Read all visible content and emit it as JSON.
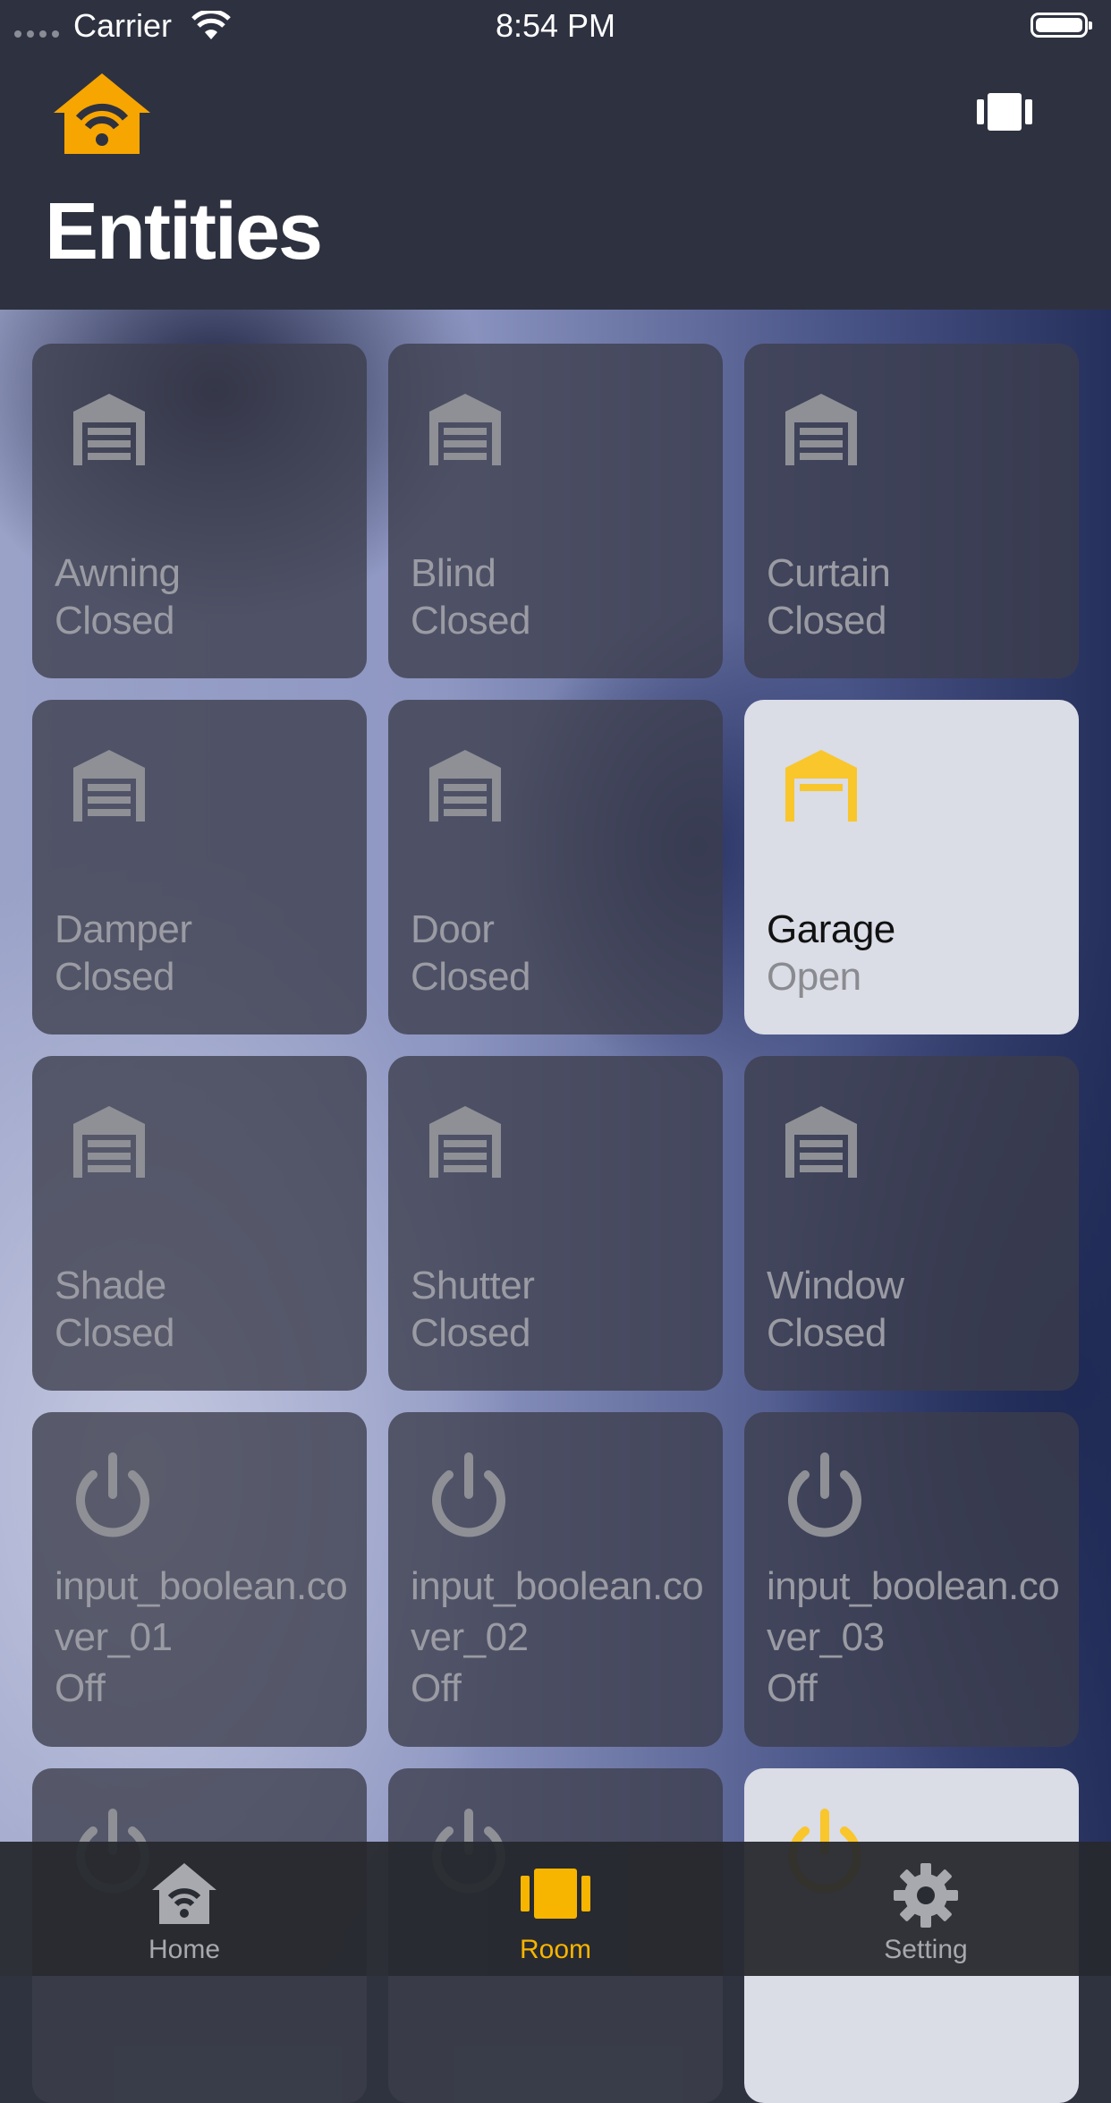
{
  "status_bar": {
    "carrier": "Carrier",
    "time": "8:54 PM"
  },
  "header": {
    "title": "Entities"
  },
  "entities": [
    {
      "name": "Awning",
      "state": "Closed",
      "icon": "garage-closed-icon",
      "active": false
    },
    {
      "name": "Blind",
      "state": "Closed",
      "icon": "garage-closed-icon",
      "active": false
    },
    {
      "name": "Curtain",
      "state": "Closed",
      "icon": "garage-closed-icon",
      "active": false
    },
    {
      "name": "Damper",
      "state": "Closed",
      "icon": "garage-closed-icon",
      "active": false
    },
    {
      "name": "Door",
      "state": "Closed",
      "icon": "garage-closed-icon",
      "active": false
    },
    {
      "name": "Garage",
      "state": "Open",
      "icon": "garage-open-icon",
      "active": true
    },
    {
      "name": "Shade",
      "state": "Closed",
      "icon": "garage-closed-icon",
      "active": false
    },
    {
      "name": "Shutter",
      "state": "Closed",
      "icon": "garage-closed-icon",
      "active": false
    },
    {
      "name": "Window",
      "state": "Closed",
      "icon": "garage-closed-icon",
      "active": false
    },
    {
      "name": "input_boolean.cover_01",
      "state": "Off",
      "icon": "power-icon",
      "active": false
    },
    {
      "name": "input_boolean.cover_02",
      "state": "Off",
      "icon": "power-icon",
      "active": false
    },
    {
      "name": "input_boolean.cover_03",
      "state": "Off",
      "icon": "power-icon",
      "active": false
    }
  ],
  "tabs": [
    {
      "label": "Home",
      "icon": "home-wifi-icon",
      "selected": false
    },
    {
      "label": "Room",
      "icon": "room-icon",
      "selected": true
    },
    {
      "label": "Setting",
      "icon": "gear-icon",
      "selected": false
    }
  ],
  "colors": {
    "accent": "#f7b500",
    "active_icon": "#f9c62b",
    "inactive_icon": "#8f9096"
  }
}
